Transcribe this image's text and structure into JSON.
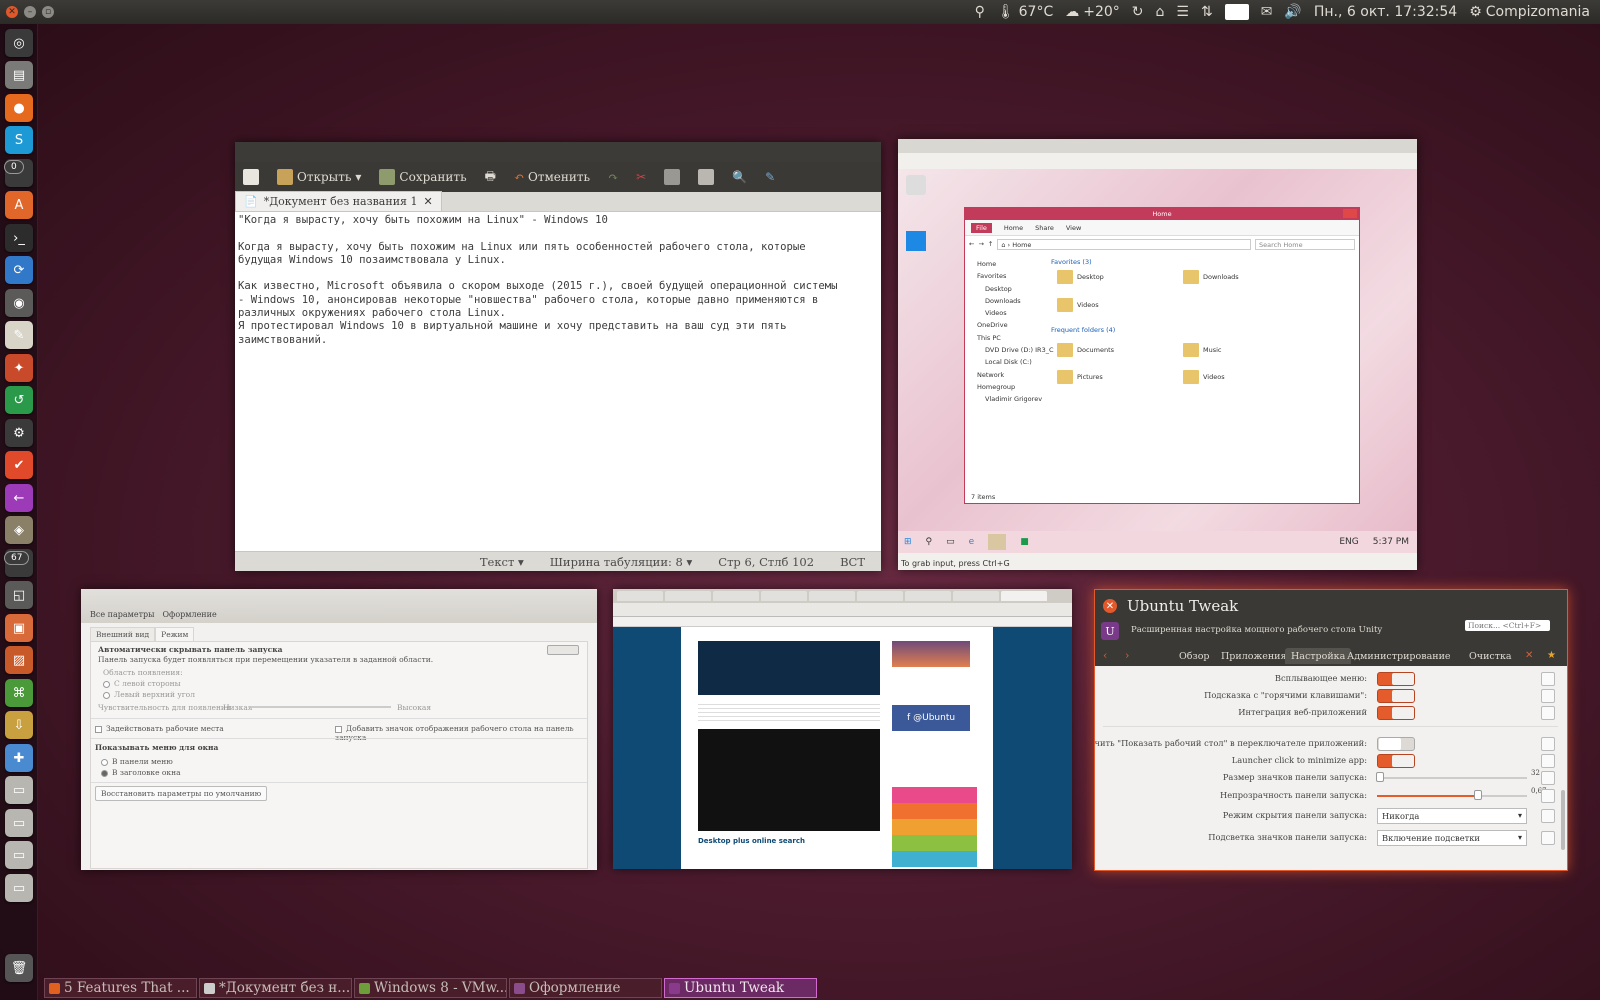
{
  "top_panel": {
    "temperature": "67°C",
    "weather": "+20°",
    "datetime": "Пн., 6 окт. 17:32:54",
    "user": "Compizomania"
  },
  "launcher": {
    "badges": [
      "0",
      "67"
    ],
    "icons": [
      "ubuntu-dash-icon",
      "files-icon",
      "firefox-icon",
      "skype-icon",
      "badge-app-icon",
      "software-center-icon",
      "terminal-icon",
      "sync-icon",
      "camera-icon",
      "text-editor-icon",
      "settings-tool-icon",
      "update-icon",
      "system-settings-icon",
      "todo-icon",
      "back-icon",
      "gear-folder-icon",
      "badge-app2-icon",
      "screenshot-icon",
      "image-viewer-icon",
      "photo-icon",
      "mint-app-icon",
      "downloads-icon",
      "tweak-icon",
      "drive-icon",
      "drive2-icon",
      "drive3-icon",
      "drive4-icon",
      "trash-icon"
    ]
  },
  "gedit": {
    "toolbar": {
      "open": "Открыть",
      "save": "Сохранить",
      "undo": "Отменить"
    },
    "tab": "*Документ без названия 1",
    "lines": [
      "\"Когда я вырасту, хочу быть похожим на Linux\" - Windows 10",
      "",
      "Когда я вырасту, хочу быть похожим на Linux или пять особенностей рабочего стола, которые",
      "будущая Windows 10 позаимствовала у Linux.",
      "",
      "Как известно, Microsoft объявила о скором выходе (2015 г.), своей будущей операционной системы",
      "- Windows 10, анонсировав некоторые \"новшества\" рабочего стола, которые давно применяются в",
      "различных окружениях рабочего стола Linux.",
      "Я протестировал Windows 10 в виртуальной машине и хочу представить на ваш суд эти пять",
      "заимствований."
    ],
    "status": {
      "mode": "Текст",
      "tab_width": "Ширина табуляции: 8",
      "position": "Стр 6, Стлб 102",
      "insert": "ВСТ"
    }
  },
  "vmware": {
    "explorer_title": "Home",
    "ribbon": [
      "File",
      "Home",
      "Share",
      "View"
    ],
    "address": "Home",
    "search_placeholder": "Search Home",
    "nav": [
      "Home",
      "Favorites",
      "Desktop",
      "Downloads",
      "Videos",
      "OneDrive",
      "This PC",
      "DVD Drive (D:) IR3_C",
      "Local Disk (C:)",
      "Network",
      "Homegroup",
      "Vladimir Grigorev"
    ],
    "favorites_header": "Favorites (3)",
    "frequent_header": "Frequent folders (4)",
    "items": [
      "Desktop",
      "Downloads",
      "Videos",
      "Documents",
      "Music",
      "Pictures",
      "Videos"
    ],
    "items_count": "7 items",
    "tray_lang": "ENG",
    "clock": "5:37 PM",
    "grab_hint": "To grab input, press Ctrl+G"
  },
  "settings": {
    "head": [
      "Все параметры",
      "Оформление"
    ],
    "tabs": [
      "Внешний вид",
      "Режим"
    ],
    "autohide_title": "Автоматически скрывать панель запуска",
    "autohide_desc": "Панель запуска будет появляться при перемещении указателя в заданной области.",
    "area_label": "Область появления:",
    "area_options": [
      "С левой стороны",
      "Левый верхний угол"
    ],
    "sensitivity_label": "Чувствительность для появления",
    "sens_low": "Низкая",
    "sens_high": "Высокая",
    "workspaces": "Задействовать рабочие места",
    "show_desktop": "Добавить значок отображения рабочего стола на панель запуска",
    "menus_title": "Показывать меню для окна",
    "menu_options": [
      "В панели меню",
      "В заголовке окна"
    ],
    "reset": "Восстановить параметры по умолчанию"
  },
  "browser": {
    "facebook_label": "@Ubuntu",
    "caption": "Desktop plus online search"
  },
  "tweak": {
    "title": "Ubuntu Tweak",
    "subtitle": "Расширенная настройка мощного рабочего стола Unity",
    "search_placeholder": "Поиск... <Ctrl+F>",
    "tabs": [
      "Обзор",
      "Приложения",
      "Настройка",
      "Администрирование",
      "Очистка"
    ],
    "rows": [
      {
        "label": "Всплывающее меню:",
        "type": "switch",
        "on": true
      },
      {
        "label": "Подсказка с \"горячими клавишами\":",
        "type": "switch",
        "on": true
      },
      {
        "label": "Интеграция веб-приложений",
        "type": "switch",
        "on": true
      },
      {
        "label": "Отключить \"Показать рабочий стол\" в переключателе приложений:",
        "type": "switch",
        "on": false
      },
      {
        "label": "Launcher click to minimize app:",
        "type": "switch",
        "on": true
      },
      {
        "label": "Размер значков панели запуска:",
        "type": "slider",
        "value": "32"
      },
      {
        "label": "Непрозрачность панели запуска:",
        "type": "slider",
        "value": "0,67"
      },
      {
        "label": "Режим скрытия панели запуска:",
        "type": "combo",
        "value": "Никогда"
      },
      {
        "label": "Подсветка значков панели запуска:",
        "type": "combo",
        "value": "Включение подсветки"
      }
    ]
  },
  "taskbar": [
    {
      "label": "5 Features That ...",
      "active": false,
      "color": "#e06020"
    },
    {
      "label": "*Документ без н...",
      "active": false,
      "color": "#cccccc"
    },
    {
      "label": "Windows 8 - VMw...",
      "active": false,
      "color": "#6d9e3a"
    },
    {
      "label": "Оформление",
      "active": false,
      "color": "#8a4c8a"
    },
    {
      "label": "Ubuntu Tweak",
      "active": true,
      "color": "#8a3a8a"
    }
  ]
}
